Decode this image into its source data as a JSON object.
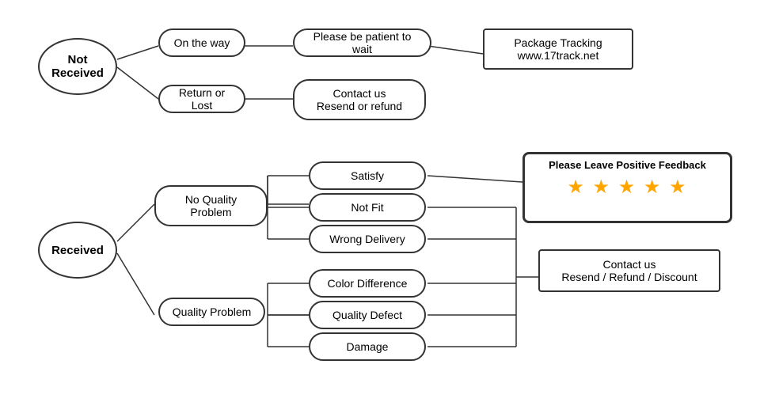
{
  "nodes": {
    "not_received": {
      "label": "Not\nReceived"
    },
    "received": {
      "label": "Received"
    },
    "on_the_way": {
      "label": "On the way"
    },
    "return_or_lost": {
      "label": "Return or Lost"
    },
    "patient": {
      "label": "Please be patient to wait"
    },
    "contact_resend": {
      "label": "Contact us\nResend or refund"
    },
    "package_tracking": {
      "label": "Package Tracking\nwww.17track.net"
    },
    "no_quality_problem": {
      "label": "No Quality\nProblem"
    },
    "quality_problem": {
      "label": "Quality Problem"
    },
    "satisfy": {
      "label": "Satisfy"
    },
    "not_fit": {
      "label": "Not Fit"
    },
    "wrong_delivery": {
      "label": "Wrong Delivery"
    },
    "color_difference": {
      "label": "Color Difference"
    },
    "quality_defect": {
      "label": "Quality Defect"
    },
    "damage": {
      "label": "Damage"
    },
    "contact_refund": {
      "label": "Contact us\nResend / Refund / Discount"
    },
    "feedback": {
      "label": "Please Leave Positive Feedback"
    },
    "stars": {
      "label": "★ ★ ★ ★ ★"
    }
  }
}
